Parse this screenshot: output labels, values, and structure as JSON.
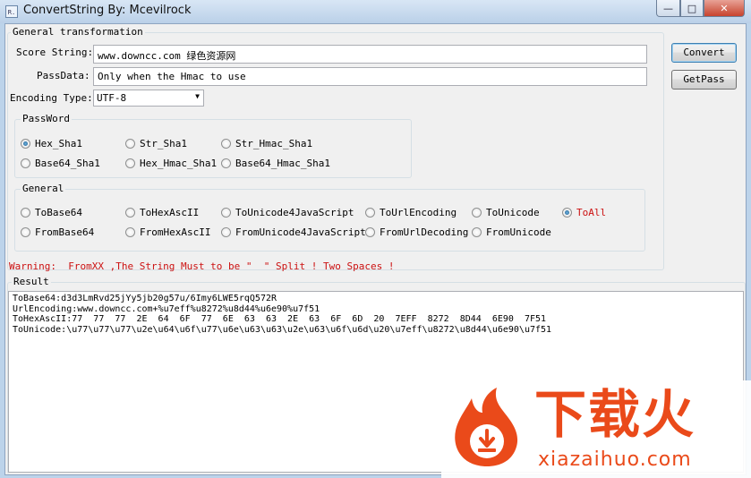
{
  "window": {
    "title": "ConvertString By: Mcevilrock",
    "icon_text": "R."
  },
  "general_transformation": {
    "title": "General transformation",
    "score_label": "Score String:",
    "score_value": "www.downcc.com 绿色资源网",
    "pass_label": "PassData:",
    "pass_value": "Only when the Hmac to use",
    "encoding_label": "Encoding Type:",
    "encoding_value": "UTF-8",
    "convert_button": "Convert",
    "getpass_button": "GetPass"
  },
  "password_group": {
    "title": "PassWord",
    "options": [
      {
        "label": "Hex_Sha1",
        "selected": true
      },
      {
        "label": "Str_Sha1",
        "selected": false
      },
      {
        "label": "Str_Hmac_Sha1",
        "selected": false
      },
      {
        "label": "Base64_Sha1",
        "selected": false
      },
      {
        "label": "Hex_Hmac_Sha1",
        "selected": false
      },
      {
        "label": "Base64_Hmac_Sha1",
        "selected": false
      }
    ]
  },
  "general_group": {
    "title": "General",
    "options": [
      {
        "label": "ToBase64",
        "selected": false
      },
      {
        "label": "ToHexAscII",
        "selected": false
      },
      {
        "label": "ToUnicode4JavaScript",
        "selected": false
      },
      {
        "label": "ToUrlEncoding",
        "selected": false
      },
      {
        "label": "ToUnicode",
        "selected": false
      },
      {
        "label": "ToAll",
        "selected": true
      },
      {
        "label": "FromBase64",
        "selected": false
      },
      {
        "label": "FromHexAscII",
        "selected": false
      },
      {
        "label": "FromUnicode4JavaScript",
        "selected": false
      },
      {
        "label": "FromUrlDecoding",
        "selected": false
      },
      {
        "label": "FromUnicode",
        "selected": false
      }
    ]
  },
  "warning": "Warning:  FromXX ,The String Must to be \"  \" Split ! Two Spaces !",
  "result": {
    "title": "Result",
    "lines": [
      "ToBase64:d3d3LmRvd25jYy5jb20g57u/6Imy6LWE5rqQ572R",
      "UrlEncoding:www.downcc.com+%u7eff%u8272%u8d44%u6e90%u7f51",
      "ToHexAscII:77  77  77  2E  64  6F  77  6E  63  63  2E  63  6F  6D  20  7EFF  8272  8D44  6E90  7F51",
      "ToUnicode:\\u77\\u77\\u77\\u2e\\u64\\u6f\\u77\\u6e\\u63\\u63\\u2e\\u63\\u6f\\u6d\\u20\\u7eff\\u8272\\u8d44\\u6e90\\u7f51"
    ]
  },
  "watermark": {
    "text": "下载火",
    "url": "xiazaihuo.com"
  },
  "colors": {
    "warning": "#cc1111",
    "watermark": "#ea4a1a"
  }
}
